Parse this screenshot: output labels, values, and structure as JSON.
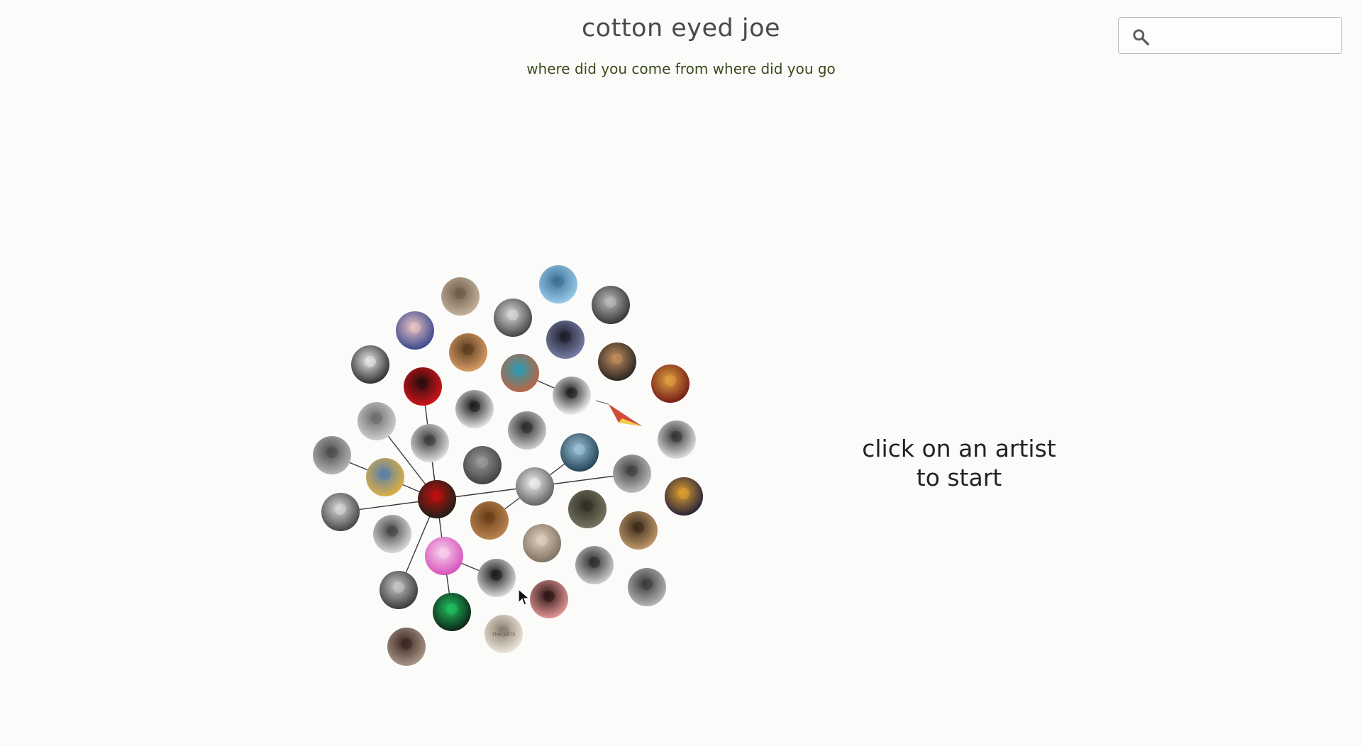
{
  "header": {
    "title": "cotton eyed joe",
    "subtitle": "where did you come from where did you go"
  },
  "search": {
    "placeholder": "",
    "value": "",
    "icon": "search-icon"
  },
  "hint": {
    "line1": "click on an artist",
    "line2": "to start"
  },
  "graph": {
    "artists": [
      {
        "id": "a1",
        "photo": [
          "#c8b8a4",
          "#6f5b49"
        ]
      },
      {
        "id": "a2",
        "photo": [
          "#9fd0ef",
          "#3d6f94"
        ]
      },
      {
        "id": "a3",
        "photo": [
          "#2c2c2c",
          "#bcbcbc"
        ]
      },
      {
        "id": "a4",
        "photo": [
          "#3a3a3a",
          "#d9d9d9"
        ]
      },
      {
        "id": "a5",
        "photo": [
          "#2e3f8a",
          "#e8c2c2"
        ]
      },
      {
        "id": "a6",
        "photo": [
          "#e0a56a",
          "#5a3a1f"
        ]
      },
      {
        "id": "a7",
        "photo": [
          "#7d86b0",
          "#1e1e2a"
        ]
      },
      {
        "id": "a8",
        "photo": [
          "#1f1f1f",
          "#c28c5c"
        ]
      },
      {
        "id": "a9",
        "photo": [
          "#222222",
          "#e6e6e6"
        ]
      },
      {
        "id": "a10",
        "photo": [
          "#d9161c",
          "#2a0d0d"
        ]
      },
      {
        "id": "a11",
        "photo": [
          "#c2603c",
          "#2c9bb0"
        ]
      },
      {
        "id": "a12",
        "photo": [
          "#6b1414",
          "#e0a040"
        ]
      },
      {
        "id": "a13",
        "photo": [
          "#d6d6d6",
          "#6b6b6b"
        ]
      },
      {
        "id": "a14",
        "photo": [
          "#ffffff",
          "#1f1f1f"
        ]
      },
      {
        "id": "a15",
        "photo": [
          "#f2f2f2",
          "#1c1c1c"
        ]
      },
      {
        "id": "a16",
        "photo": [
          "#bdbdbd",
          "#4a4a4a"
        ]
      },
      {
        "id": "a17",
        "photo": [
          "#ececec",
          "#3a3a3a"
        ]
      },
      {
        "id": "a18",
        "photo": [
          "#d9d9d9",
          "#2a2a2a"
        ]
      },
      {
        "id": "a19",
        "photo": [
          "#e8b33c",
          "#5a7fa8"
        ]
      },
      {
        "id": "a20",
        "photo": [
          "#3a3a3a",
          "#9a9a9a"
        ]
      },
      {
        "id": "a21",
        "photo": [
          "#1c3b4f",
          "#9bc2d6"
        ]
      },
      {
        "id": "a22",
        "photo": [
          "#c7c7c7",
          "#3f3f3f"
        ]
      },
      {
        "id": "a23",
        "photo": [
          "#585858",
          "#efefef"
        ]
      },
      {
        "id": "a24",
        "photo": [
          "#7d7a66",
          "#2f2d22"
        ]
      },
      {
        "id": "a25",
        "photo": [
          "#132018",
          "#c01010"
        ]
      },
      {
        "id": "a26",
        "photo": [
          "#3a3a3a",
          "#d9d9d9"
        ]
      },
      {
        "id": "a27",
        "photo": [
          "#e4e4e4",
          "#444444"
        ]
      },
      {
        "id": "a28",
        "photo": [
          "#c8a070",
          "#3a2a1a"
        ]
      },
      {
        "id": "a29",
        "photo": [
          "#c08a52",
          "#6a3e1a"
        ]
      },
      {
        "id": "a30",
        "photo": [
          "#ececec",
          "#8a4a3a"
        ]
      },
      {
        "id": "a31",
        "photo": [
          "#d8d8d8",
          "#2c2c2c"
        ]
      },
      {
        "id": "a32",
        "photo": [
          "#d44ab6",
          "#f8d2ee"
        ]
      },
      {
        "id": "a33",
        "photo": [
          "#e8e8e8",
          "#1a1a1a"
        ]
      },
      {
        "id": "a34",
        "photo": [
          "#7a6a5a",
          "#e0d0c0"
        ]
      },
      {
        "id": "a35",
        "photo": [
          "#bdbdbd",
          "#3a3a3a"
        ]
      },
      {
        "id": "a36",
        "photo": [
          "#1a1a3a",
          "#e0a030"
        ]
      },
      {
        "id": "a37",
        "photo": [
          "#2e2e2e",
          "#c8c8c8"
        ]
      },
      {
        "id": "a38",
        "photo": [
          "#f2a0a0",
          "#2a1414"
        ]
      },
      {
        "id": "a39",
        "photo": [
          "#0a1a10",
          "#22c060"
        ]
      },
      {
        "id": "a40",
        "photo": [
          "#f3ece0",
          "#8a8070"
        ],
        "label": "The 1975"
      },
      {
        "id": "a41",
        "photo": [
          "#b0a090",
          "#3a2520"
        ]
      },
      {
        "id": "a42",
        "photo": [
          "#ededed",
          "#4a4a4a"
        ]
      },
      {
        "id": "a43",
        "photo": [
          "#ececec",
          "#333333"
        ]
      },
      {
        "id": "a44",
        "photo": [
          "#2c2c2c",
          "#b84040"
        ]
      },
      {
        "id": "a45",
        "photo": [
          "#1e1e1e",
          "#a0a0a0"
        ]
      },
      {
        "id": "a46",
        "photo": [
          "#3a3a3a",
          "#d0d0d0"
        ]
      }
    ],
    "links": [
      [
        "a11",
        "a14"
      ],
      [
        "a14",
        "a44"
      ],
      [
        "a10",
        "a25"
      ],
      [
        "a13",
        "a25"
      ],
      [
        "a17",
        "a25"
      ],
      [
        "a19",
        "a25"
      ],
      [
        "a22",
        "a25"
      ],
      [
        "a25",
        "a26"
      ],
      [
        "a25",
        "a32"
      ],
      [
        "a25",
        "a37"
      ],
      [
        "a32",
        "a33"
      ],
      [
        "a32",
        "a39"
      ],
      [
        "a21",
        "a23"
      ],
      [
        "a23",
        "a29"
      ],
      [
        "a16",
        "a19"
      ]
    ]
  }
}
